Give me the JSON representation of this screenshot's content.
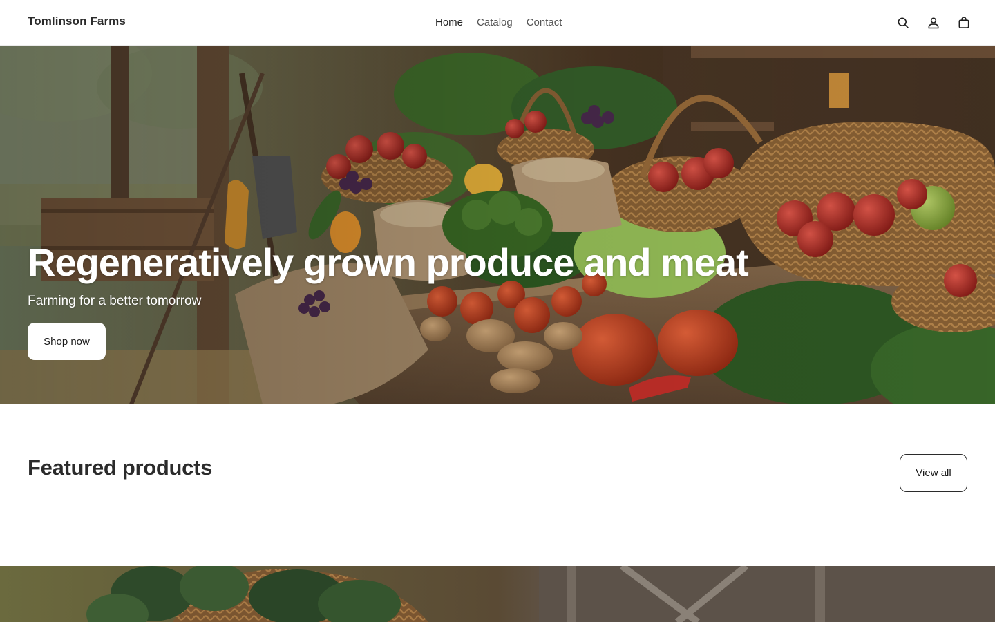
{
  "header": {
    "brand": "Tomlinson Farms",
    "nav": [
      {
        "label": "Home",
        "active": true
      },
      {
        "label": "Catalog",
        "active": false
      },
      {
        "label": "Contact",
        "active": false
      }
    ],
    "icons": [
      "search-icon",
      "account-icon",
      "cart-icon"
    ]
  },
  "hero": {
    "title": "Regeneratively grown produce and meat",
    "subtitle": "Farming for a better tomorrow",
    "cta": "Shop now"
  },
  "featured": {
    "title": "Featured products",
    "view_all": "View all"
  },
  "colors": {
    "text": "#2b2b2b",
    "background": "#ffffff",
    "button_border": "#2b2b2b"
  }
}
